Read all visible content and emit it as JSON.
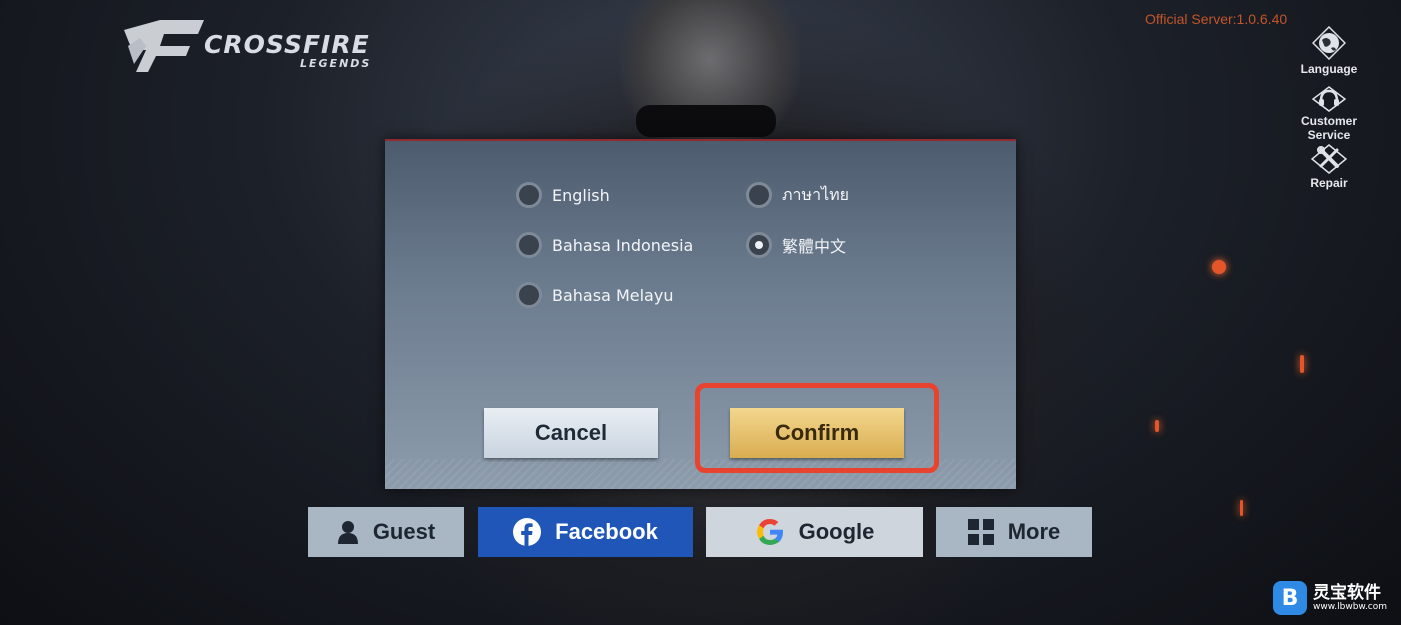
{
  "game": {
    "logo_text": "CROSSFIRE",
    "logo_subtitle": "LEGENDS"
  },
  "server_label": "Official Server:1.0.6.40",
  "side_menu": [
    {
      "label": "Language",
      "icon": "globe-icon"
    },
    {
      "label_line1": "Customer",
      "label_line2": "Service",
      "icon": "headset-icon"
    },
    {
      "label": "Repair",
      "icon": "wrench-screwdriver-icon"
    }
  ],
  "language_dialog": {
    "options": [
      {
        "label": "English",
        "selected": false
      },
      {
        "label": "ภาษาไทย",
        "selected": false
      },
      {
        "label": "Bahasa Indonesia",
        "selected": false
      },
      {
        "label": "繁體中文",
        "selected": true
      },
      {
        "label": "Bahasa Melayu",
        "selected": false
      }
    ],
    "cancel_label": "Cancel",
    "confirm_label": "Confirm"
  },
  "login_buttons": {
    "guest": "Guest",
    "facebook": "Facebook",
    "google": "Google",
    "more": "More"
  },
  "watermark": {
    "line1": "灵宝软件",
    "line2": "www.lbwbw.com"
  },
  "colors": {
    "accent_red": "#e8432e",
    "confirm_gold": "#d9ad51",
    "facebook_blue": "#1f56b8",
    "server_orange": "#c2552a"
  }
}
